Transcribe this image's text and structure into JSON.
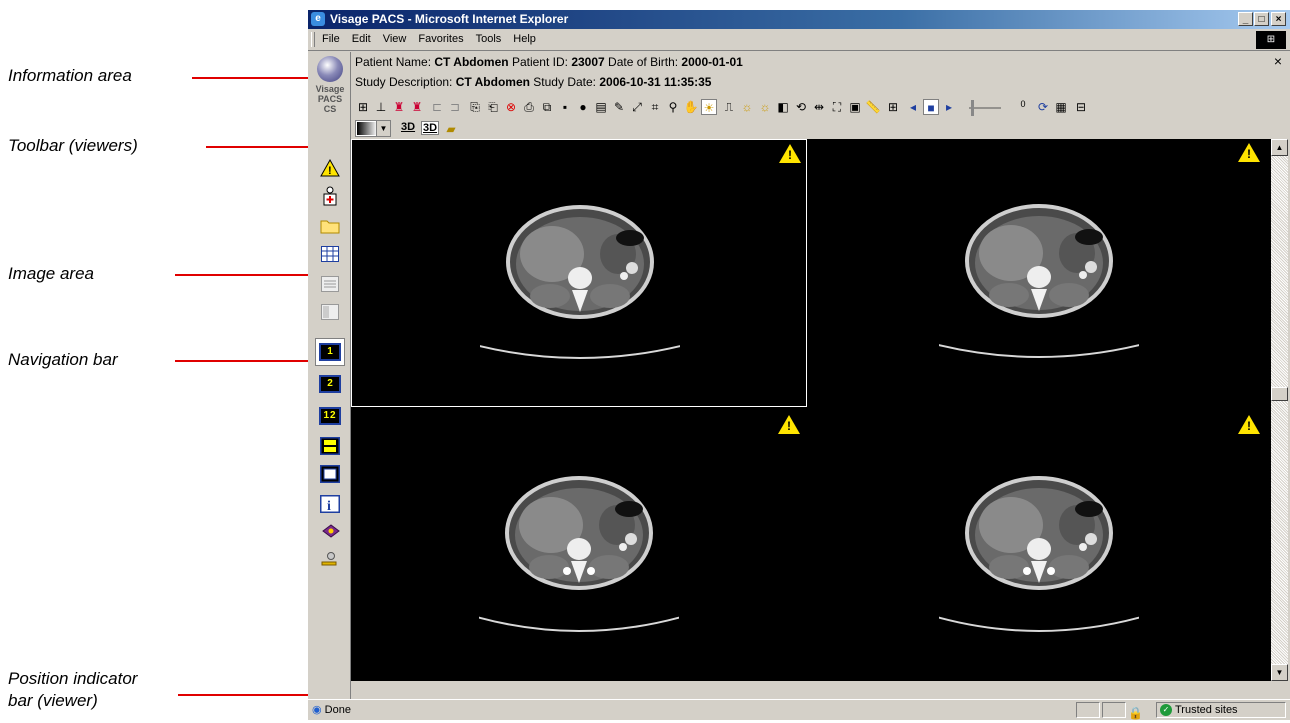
{
  "annotations": {
    "information_area": "Information area",
    "toolbar": "Toolbar (viewers)",
    "image_area": "Image area",
    "navigation_bar": "Navigation bar",
    "position_indicator_line1": "Position indicator",
    "position_indicator_line2": "bar (viewer)"
  },
  "window": {
    "title": "Visage PACS - Microsoft Internet Explorer",
    "controls": {
      "minimize": "_",
      "maximize": "□",
      "close": "×"
    }
  },
  "menu": [
    "File",
    "Edit",
    "View",
    "Favorites",
    "Tools",
    "Help"
  ],
  "logo": {
    "line1": "Visage",
    "line2": "PACS",
    "line3": "CS"
  },
  "info": {
    "patient_name_label": "Patient Name:",
    "patient_name": "CT Abdomen",
    "patient_id_label": "Patient ID:",
    "patient_id": "23007",
    "dob_label": "Date of Birth:",
    "dob": "2000-01-01",
    "study_desc_label": "Study Description:",
    "study_desc": "CT Abdomen",
    "study_date_label": "Study Date:",
    "study_date": "2006-10-31 11:35:35",
    "close": "×"
  },
  "toolbar": {
    "slider_value": "0",
    "tool_3d_a": "3D",
    "tool_3d_b": "3D"
  },
  "navbar": {
    "layout_1": "1",
    "layout_2": "2",
    "layout_12": "12"
  },
  "viewports": [
    {
      "name": "viewport-1",
      "warning": "!",
      "selected": true
    },
    {
      "name": "viewport-2",
      "warning": "!",
      "selected": false
    },
    {
      "name": "viewport-3",
      "warning": "!",
      "selected": false
    },
    {
      "name": "viewport-4",
      "warning": "!",
      "selected": false
    }
  ],
  "status": {
    "done": "Done",
    "zone": "Trusted sites"
  },
  "colors": {
    "annotation_line": "#e00000",
    "titlebar": "#0a246a",
    "warning": "#ffe400"
  }
}
